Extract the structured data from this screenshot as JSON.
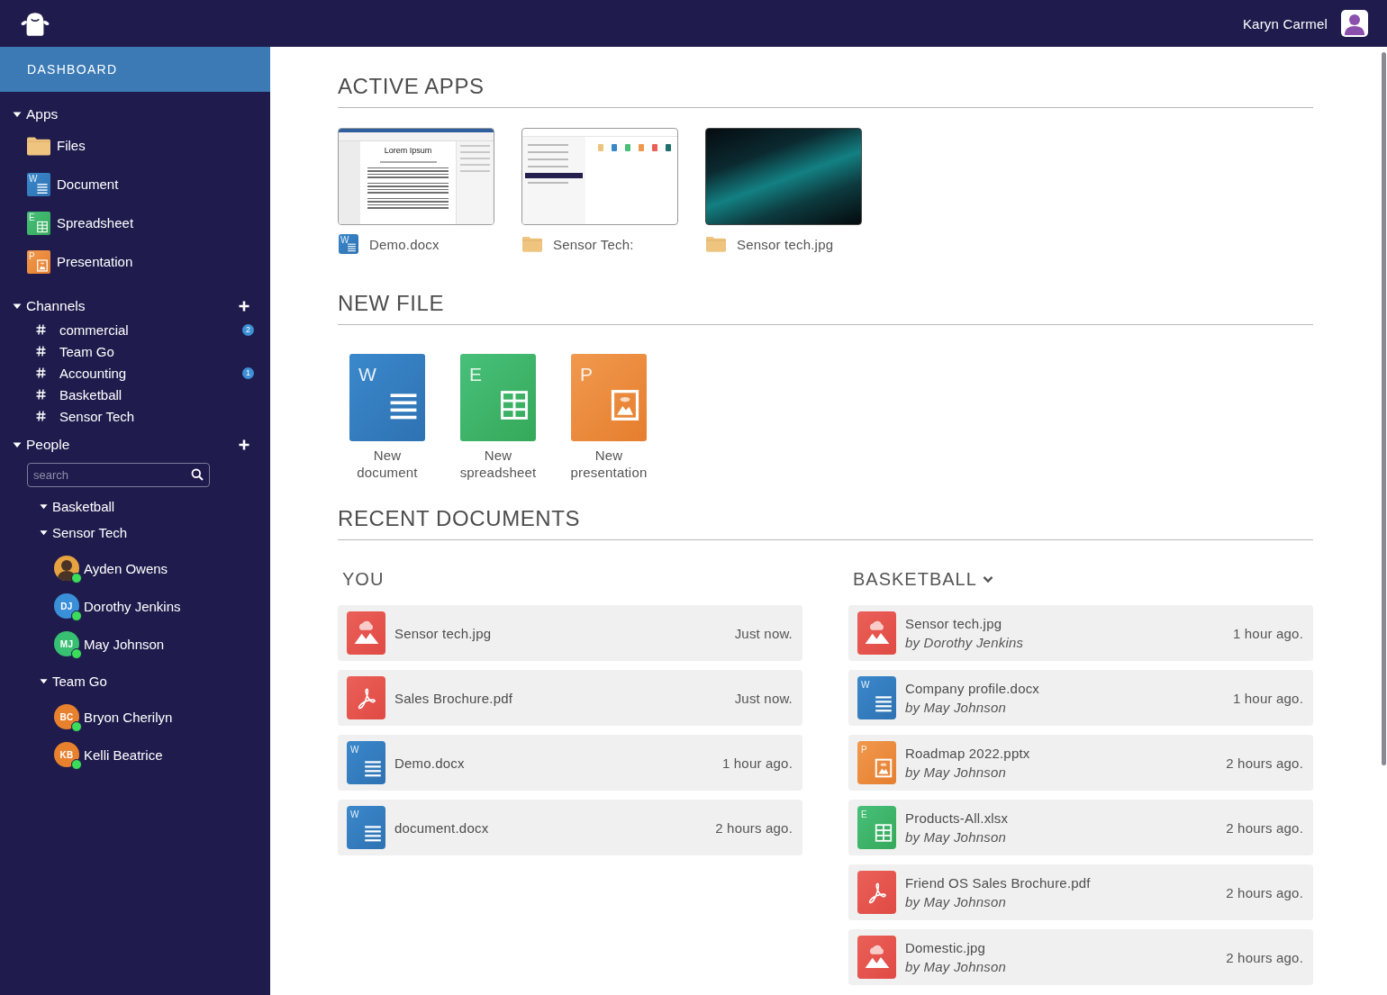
{
  "header": {
    "user_name": "Karyn Carmel"
  },
  "sidebar": {
    "dashboard": {
      "label": "DASHBOARD",
      "selected": true
    },
    "apps": {
      "label": "Apps",
      "expanded": true,
      "items": [
        {
          "label": "Files",
          "kind": "folder"
        },
        {
          "label": "Document",
          "kind": "document",
          "letter": "W"
        },
        {
          "label": "Spreadsheet",
          "kind": "spreadsheet",
          "letter": "E"
        },
        {
          "label": "Presentation",
          "kind": "presentation",
          "letter": "P"
        }
      ]
    },
    "channels": {
      "label": "Channels",
      "expanded": true,
      "items": [
        {
          "name": "commercial",
          "unread": "2"
        },
        {
          "name": "Team Go"
        },
        {
          "name": "Accounting",
          "unread": "1"
        },
        {
          "name": "Basketball"
        },
        {
          "name": "Sensor Tech"
        }
      ]
    },
    "people": {
      "label": "People",
      "expanded": true,
      "search": {
        "placeholder": "search"
      },
      "groups": [
        {
          "label": "Basketball",
          "expanded": true
        },
        {
          "label": "Sensor Tech",
          "expanded": true,
          "children": [
            {
              "name": "Ayden Owens",
              "kind": "photo",
              "online": true
            },
            {
              "name": "Dorothy Jenkins",
              "kind": "initials",
              "initials": "DJ",
              "color": "#3a8fd9",
              "online": true
            },
            {
              "name": "May Johnson",
              "kind": "initials",
              "initials": "MJ",
              "color": "#37bf72",
              "online": true
            }
          ]
        },
        {
          "label": "Team Go",
          "expanded": true,
          "children": [
            {
              "name": "Bryon Cherilyn",
              "kind": "initials",
              "initials": "BC",
              "color": "#e8812e",
              "online": true
            },
            {
              "name": "Kelli Beatrice",
              "kind": "initials",
              "initials": "KB",
              "color": "#e8812e",
              "online": true
            }
          ]
        }
      ]
    }
  },
  "active_apps": {
    "title": "ACTIVE APPS",
    "items": [
      {
        "kind": "document",
        "preview_title": "Lorem Ipsum",
        "letter": "W",
        "label": "Demo.docx"
      },
      {
        "kind": "folder",
        "label": "Sensor Tech:"
      },
      {
        "kind": "image",
        "label": "Sensor tech.jpg"
      }
    ]
  },
  "new_file": {
    "title": "NEW FILE",
    "items": [
      {
        "label": "New document",
        "kind": "document",
        "letter": "W"
      },
      {
        "label": "New spreadsheet",
        "kind": "spreadsheet",
        "letter": "E"
      },
      {
        "label": "New presentation",
        "kind": "presentation",
        "letter": "P"
      }
    ]
  },
  "recent_documents": {
    "title": "RECENT DOCUMENTS",
    "columns": [
      {
        "title": "YOU",
        "dropdown": false,
        "rows": [
          {
            "kind": "image",
            "name": "Sensor tech.jpg",
            "time": "Just now."
          },
          {
            "kind": "pdf",
            "name": "Sales Brochure.pdf",
            "time": "Just now."
          },
          {
            "kind": "document",
            "letter": "W",
            "name": "Demo.docx",
            "time": "1 hour ago."
          },
          {
            "kind": "document",
            "letter": "W",
            "name": "document.docx",
            "time": "2 hours ago."
          }
        ]
      },
      {
        "title": "BASKETBALL",
        "dropdown": true,
        "rows": [
          {
            "kind": "image",
            "name": "Sensor tech.jpg",
            "author": "by Dorothy Jenkins",
            "time": "1 hour ago."
          },
          {
            "kind": "document",
            "letter": "W",
            "name": "Company profile.docx",
            "author": "by May Johnson",
            "time": "1 hour ago."
          },
          {
            "kind": "presentation",
            "letter": "P",
            "name": "Roadmap 2022.pptx",
            "author": "by May Johnson",
            "time": "2 hours ago."
          },
          {
            "kind": "spreadsheet",
            "letter": "E",
            "name": "Products-All.xlsx",
            "author": "by May Johnson",
            "time": "2 hours ago."
          },
          {
            "kind": "pdf",
            "name": "Friend OS Sales Brochure.pdf",
            "author": "by May Johnson",
            "time": "2 hours ago."
          },
          {
            "kind": "image",
            "name": "Domestic.jpg",
            "author": "by May Johnson",
            "time": "2 hours ago."
          }
        ]
      }
    ]
  }
}
